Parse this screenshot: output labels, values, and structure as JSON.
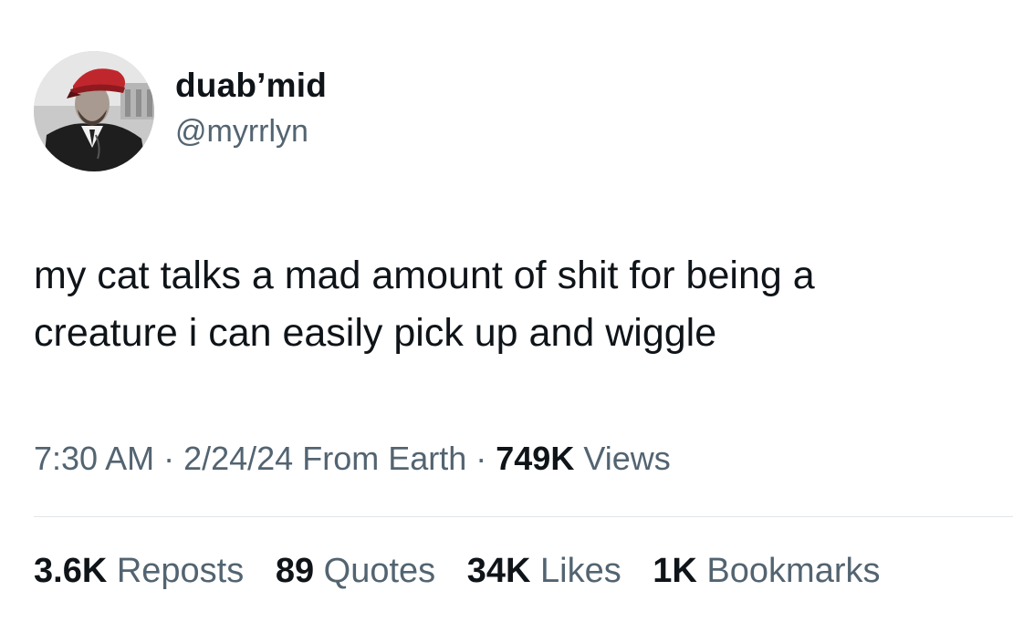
{
  "user": {
    "display_name": "duab’mid",
    "handle": "@myrrlyn"
  },
  "tweet": {
    "lines": [
      "my cat talks a mad amount of shit for being a",
      "creature i can easily pick up and wiggle"
    ]
  },
  "meta": {
    "time": "7:30 AM",
    "sep1": " · ",
    "date": "2/24/24",
    "source": " From Earth",
    "sep2": " · ",
    "views_count": "749K",
    "views_label": " Views"
  },
  "stats": [
    {
      "count": "3.6K",
      "label": " Reposts"
    },
    {
      "count": "89",
      "label": " Quotes"
    },
    {
      "count": "34K",
      "label": " Likes"
    },
    {
      "count": "1K",
      "label": " Bookmarks"
    }
  ],
  "colors": {
    "text": "#0f1419",
    "secondary": "#536471",
    "divider": "#e3e7ea",
    "hat": "#c0272d"
  }
}
